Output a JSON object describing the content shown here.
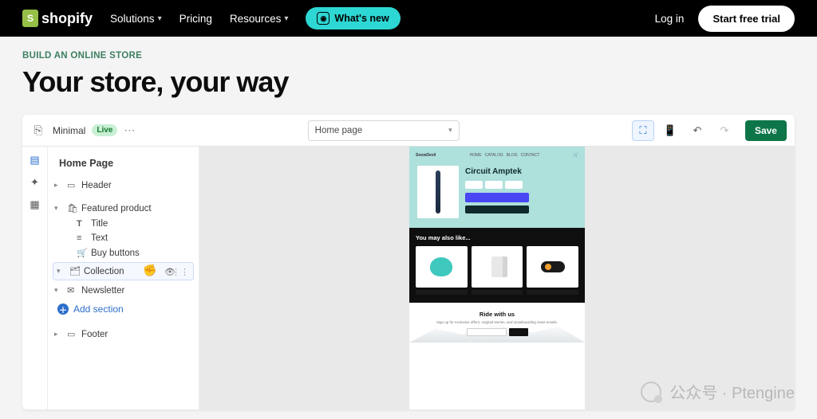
{
  "nav": {
    "brand": "shopify",
    "items": [
      "Solutions",
      "Pricing",
      "Resources"
    ],
    "whatsnew": "What's new",
    "login": "Log in",
    "trial": "Start free trial"
  },
  "hero": {
    "eyebrow": "BUILD AN ONLINE STORE",
    "title": "Your store, your way"
  },
  "editor": {
    "theme": "Minimal",
    "status": "Live",
    "page_select": "Home page",
    "save": "Save",
    "tree_title": "Home Page",
    "sections": {
      "header": "Header",
      "featured": "Featured product",
      "title_block": "Title",
      "text_block": "Text",
      "buy_block": "Buy buttons",
      "collection": "Collection",
      "newsletter": "Newsletter",
      "add": "Add section",
      "footer": "Footer"
    }
  },
  "preview": {
    "store": "SnowDevil",
    "nav": [
      "HOME",
      "CATALOG",
      "BLOG",
      "CONTACT"
    ],
    "product": "Circuit Amptek",
    "ymal": "You may also like...",
    "ride_title": "Ride with us",
    "ride_sub": "Sign up for exclusive offers, original stories, and snowboarding news emails."
  },
  "watermark": "公众号 · Ptengine"
}
